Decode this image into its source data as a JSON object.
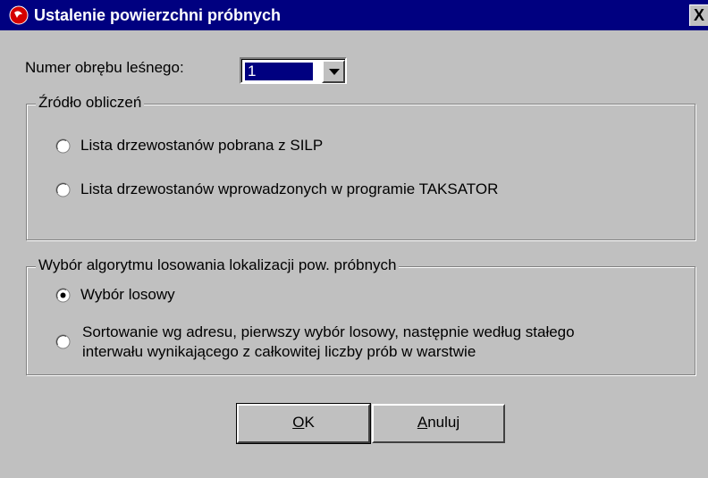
{
  "window": {
    "title": "Ustalenie powierzchni próbnych",
    "close_label": "X"
  },
  "forest_district": {
    "label": "Numer obrębu leśnego:",
    "value": "1"
  },
  "source_group": {
    "legend": "Źródło obliczeń",
    "options": [
      {
        "label": "Lista drzewostanów pobrana z SILP",
        "selected": false
      },
      {
        "label": "Lista drzewostanów wprowadzonych w programie TAKSATOR",
        "selected": false
      }
    ]
  },
  "algorithm_group": {
    "legend": "Wybór algorytmu losowania lokalizacji pow. próbnych",
    "options": [
      {
        "label": "Wybór losowy",
        "selected": true
      },
      {
        "label_line1": "Sortowanie wg adresu, pierwszy wybór losowy, następnie według stałego",
        "label_line2": "interwału wynikającego z całkowitej liczby prób w warstwie",
        "selected": false
      }
    ]
  },
  "buttons": {
    "ok": {
      "mnemonic": "O",
      "rest": "K"
    },
    "cancel": {
      "mnemonic": "A",
      "rest": "nuluj"
    }
  }
}
